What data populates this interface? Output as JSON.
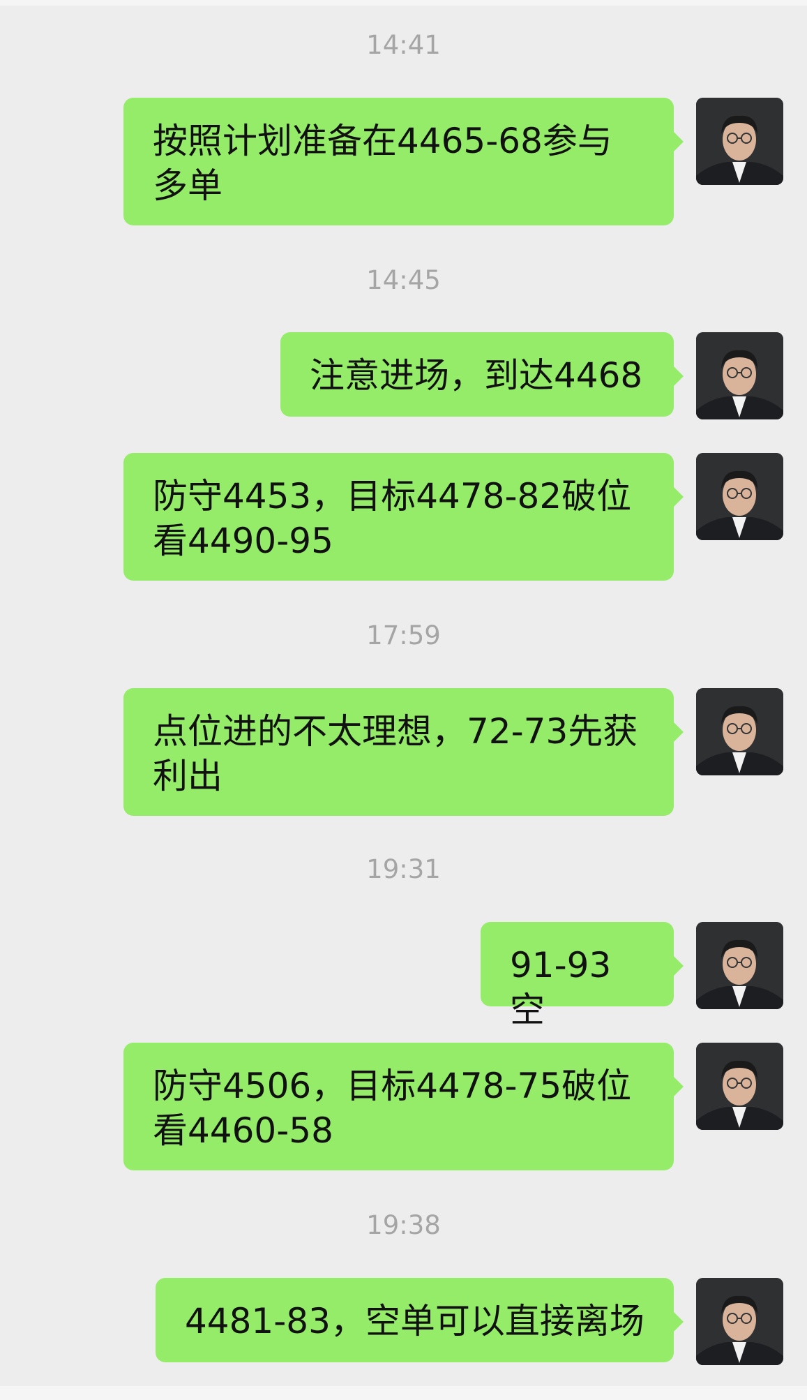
{
  "chat": {
    "timestamps": [
      "14:41",
      "14:45",
      "17:59",
      "19:31",
      "19:38"
    ],
    "messages": [
      {
        "text": "按照计划准备在4465-68参与\n多单"
      },
      {
        "text": "注意进场，到达4468"
      },
      {
        "text": "防守4453，目标4478-82破位\n看4490-95"
      },
      {
        "text": "点位进的不太理想，72-73先获\n利出"
      },
      {
        "text": "91-93空"
      },
      {
        "text": "防守4506，目标4478-75破位\n看4460-58"
      },
      {
        "text": "4481-83，空单可以直接离场"
      }
    ],
    "colors": {
      "background": "#ededed",
      "bubble": "#95ec69",
      "timestamp": "#a5a5a5",
      "text": "#111111"
    }
  }
}
